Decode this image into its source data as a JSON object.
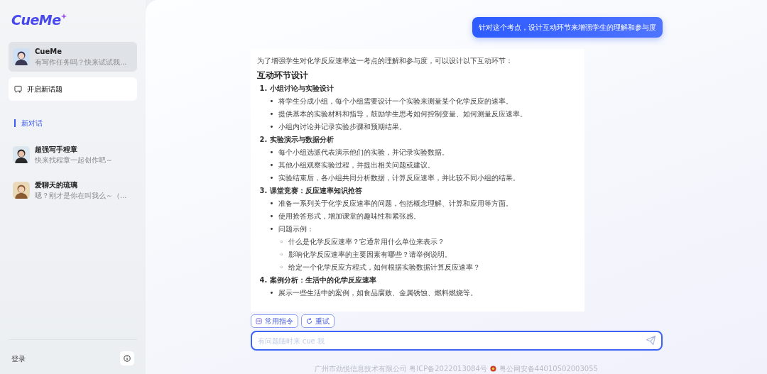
{
  "logo": {
    "text": "CueMe"
  },
  "sidebar": {
    "bots": [
      {
        "name": "CueMe",
        "preview": "有写作任务吗？快来试试我...",
        "selected": true
      },
      {
        "name": "开启新话题",
        "kind": "action"
      }
    ],
    "section_label": "新对话",
    "agents": [
      {
        "name": "超强写手程章",
        "preview": "快来找程章一起创作吧～",
        "selected": false
      },
      {
        "name": "爱聊天的琉璃",
        "preview": "嗯？刚才是你在叫我么～（...",
        "selected": false
      }
    ],
    "login": "登录"
  },
  "chat": {
    "user_message": "针对这个考点，设计互动环节来增强学生的理解和参与度",
    "answer": {
      "intro": "为了增强学生对化学反应速率这一考点的理解和参与度，可以设计以下互动环节：",
      "heading": "互动环节设计",
      "sections": [
        {
          "number": "1.",
          "title": "小组讨论与实验设计",
          "items": [
            {
              "marker": "•",
              "text": "将学生分成小组，每个小组需要设计一个实验来测量某个化学反应的速率。"
            },
            {
              "marker": "•",
              "text": "提供基本的实验材料和指导，鼓励学生思考如何控制变量、如何测量反应速率。"
            },
            {
              "marker": "•",
              "text": "小组内讨论并记录实验步骤和预期结果。"
            }
          ]
        },
        {
          "number": "2.",
          "title": "实验演示与数据分析",
          "items": [
            {
              "marker": "•",
              "text": "每个小组选派代表演示他们的实验，并记录实验数据。"
            },
            {
              "marker": "•",
              "text": "其他小组观察实验过程，并提出相关问题或建议。"
            },
            {
              "marker": "•",
              "text": "实验结束后，各小组共同分析数据，计算反应速率，并比较不同小组的结果。"
            }
          ]
        },
        {
          "number": "3.",
          "title": "课堂竞赛：反应速率知识抢答",
          "items": [
            {
              "marker": "•",
              "text": "准备一系列关于化学反应速率的问题，包括概念理解、计算和应用等方面。"
            },
            {
              "marker": "•",
              "text": "使用抢答形式，增加课堂的趣味性和紧张感。"
            },
            {
              "marker": "•",
              "text": "问题示例：",
              "children": [
                {
                  "marker": "◦",
                  "text": "什么是化学反应速率？它通常用什么单位来表示？"
                },
                {
                  "marker": "◦",
                  "text": "影响化学反应速率的主要因素有哪些？请举例说明。"
                },
                {
                  "marker": "◦",
                  "text": "给定一个化学反应方程式，如何根据实验数据计算反应速率？"
                }
              ]
            }
          ]
        },
        {
          "number": "4.",
          "title": "案例分析：生活中的化学反应速率",
          "items": [
            {
              "marker": "•",
              "text": "展示一些生活中的案例，如食品腐败、金属锈蚀、燃料燃烧等。"
            }
          ]
        }
      ]
    },
    "actions": [
      {
        "label": "常用指令",
        "kind": "commands"
      },
      {
        "label": "重试",
        "kind": "retry"
      }
    ],
    "input": {
      "placeholder": "有问题随时来 cue 我"
    }
  },
  "footer": {
    "company": "广州市劲悦信息技术有限公司 粤ICP备2022013084号",
    "police": "粤公网安备44010502003055"
  }
}
